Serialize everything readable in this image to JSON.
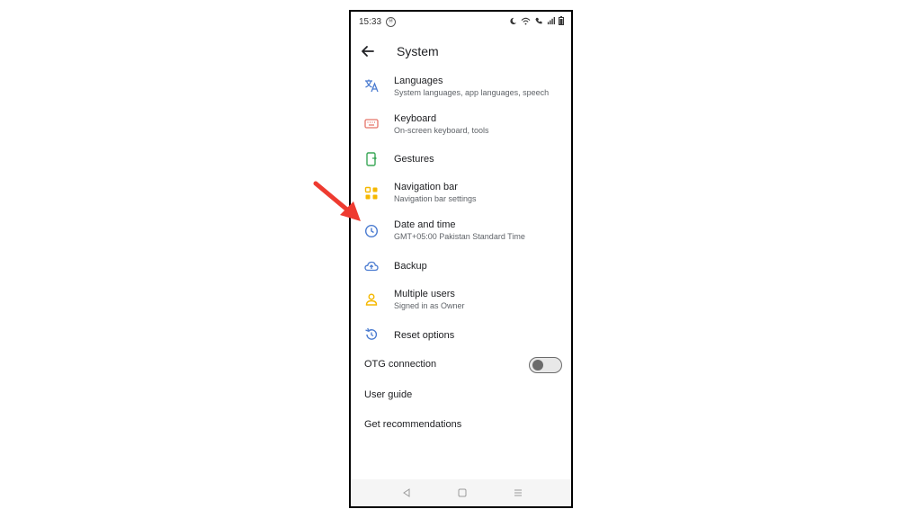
{
  "status_bar": {
    "time": "15:33",
    "badge": "Ⓜ"
  },
  "app_bar": {
    "title": "System"
  },
  "items": [
    {
      "title": "Languages",
      "subtitle": "System languages, app languages, speech",
      "icon": "translate-icon",
      "color": "#4a7bd0"
    },
    {
      "title": "Keyboard",
      "subtitle": "On-screen keyboard, tools",
      "icon": "keyboard-icon",
      "color": "#e57368"
    },
    {
      "title": "Gestures",
      "subtitle": "",
      "icon": "gestures-icon",
      "color": "#3aa757"
    },
    {
      "title": "Navigation bar",
      "subtitle": "Navigation bar settings",
      "icon": "navigation-bar-icon",
      "color": "#f5b800"
    },
    {
      "title": "Date and time",
      "subtitle": "GMT+05:00 Pakistan Standard Time",
      "icon": "clock-icon",
      "color": "#4a7bd0"
    },
    {
      "title": "Backup",
      "subtitle": "",
      "icon": "cloud-upload-icon",
      "color": "#4a7bd0"
    },
    {
      "title": "Multiple users",
      "subtitle": "Signed in as Owner",
      "icon": "user-icon",
      "color": "#f5b800"
    },
    {
      "title": "Reset options",
      "subtitle": "",
      "icon": "reset-icon",
      "color": "#4a7bd0"
    }
  ],
  "otg": {
    "label": "OTG connection",
    "enabled": false
  },
  "user_guide": "User guide",
  "recommendations": "Get recommendations",
  "annotation_color": "#ee3b30"
}
